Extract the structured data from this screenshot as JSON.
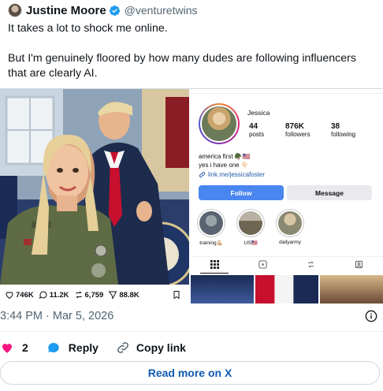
{
  "tweet": {
    "author_name": "Justine Moore",
    "author_handle": "@venturetwins",
    "line1": "It takes a lot to shock me online.",
    "line2": "But I'm genuinely floored by how many dudes are following influencers that are clearly AI.",
    "timestamp": "3:44 PM · Mar 5, 2026"
  },
  "embedded_post": {
    "replies": "746K",
    "reposts_quote": "11.2K",
    "reposts": "6,759",
    "views": "88.8K"
  },
  "instagram": {
    "name": "Jessica",
    "posts": "44",
    "posts_label": "posts",
    "followers": "876K",
    "followers_label": "followers",
    "following": "38",
    "following_label": "following",
    "bio_line1": "america first 🪖🇺🇸",
    "bio_line2": "yes i have one 👇🏻",
    "link": "link.me/jessicafoster",
    "follow_label": "Follow",
    "message_label": "Message",
    "highlights": [
      {
        "label": "training💪🏼"
      },
      {
        "label": "US🇺🇸"
      },
      {
        "label": "dailyarmy"
      }
    ]
  },
  "engagement": {
    "likes": "2",
    "reply_label": "Reply",
    "copy_link_label": "Copy link"
  },
  "read_more_label": "Read more on X",
  "colors": {
    "verified": "#1d9bf0",
    "like": "#f91880",
    "reply": "#1d9bf0",
    "read_more": "#0f5ab0",
    "follow_button": "#4a86f0"
  }
}
